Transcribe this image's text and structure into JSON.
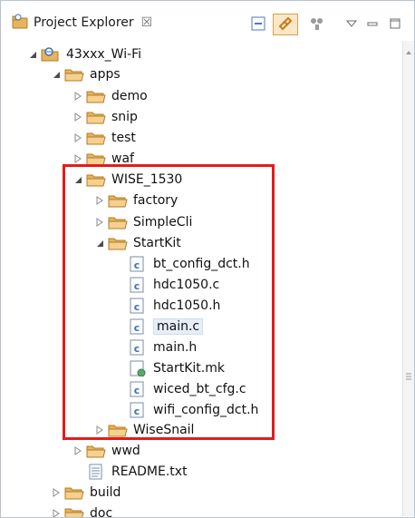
{
  "view": {
    "title": "Project Explorer",
    "close_glyph": "☒",
    "icons": [
      "project-explorer-icon",
      "close-icon",
      "collapse-all-icon",
      "link-with-editor-icon",
      "filter-icon",
      "view-menu-icon",
      "minimize-icon",
      "maximize-icon"
    ]
  },
  "tree": [
    {
      "label": "43xxx_Wi-Fi",
      "icon": "project-icon",
      "expanded": true
    },
    {
      "label": "apps",
      "icon": "folder-icon",
      "expanded": true
    },
    {
      "label": "demo",
      "icon": "folder-icon",
      "expanded": false
    },
    {
      "label": "snip",
      "icon": "folder-icon",
      "expanded": false
    },
    {
      "label": "test",
      "icon": "folder-icon",
      "expanded": false
    },
    {
      "label": "waf",
      "icon": "folder-icon",
      "expanded": false
    },
    {
      "label": "WISE_1530",
      "icon": "folder-icon",
      "expanded": true
    },
    {
      "label": "factory",
      "icon": "folder-icon",
      "expanded": false
    },
    {
      "label": "SimpleCli",
      "icon": "folder-icon",
      "expanded": false
    },
    {
      "label": "StartKit",
      "icon": "folder-icon",
      "expanded": true
    },
    {
      "label": "bt_config_dct.h",
      "icon": "c-source-file-icon"
    },
    {
      "label": "hdc1050.c",
      "icon": "c-source-file-icon"
    },
    {
      "label": "hdc1050.h",
      "icon": "c-source-file-icon"
    },
    {
      "label": "main.c",
      "icon": "c-source-file-icon",
      "selected": true
    },
    {
      "label": "main.h",
      "icon": "c-source-file-icon"
    },
    {
      "label": "StartKit.mk",
      "icon": "makefile-icon"
    },
    {
      "label": "wiced_bt_cfg.c",
      "icon": "c-source-file-icon"
    },
    {
      "label": "wifi_config_dct.h",
      "icon": "c-source-file-icon"
    },
    {
      "label": "WiseSnail",
      "icon": "folder-icon",
      "expanded": false
    },
    {
      "label": "wwd",
      "icon": "folder-icon",
      "expanded": false
    },
    {
      "label": "README.txt",
      "icon": "text-file-icon"
    },
    {
      "label": "build",
      "icon": "folder-icon",
      "expanded": false
    },
    {
      "label": "doc",
      "icon": "folder-icon",
      "expanded": false
    }
  ],
  "colors": {
    "highlight": "#e41b1b",
    "folder": "#e8b35a",
    "project": "#3a6fc0",
    "c_file": "#3f6fb6",
    "makefile": "#5aa86a"
  }
}
